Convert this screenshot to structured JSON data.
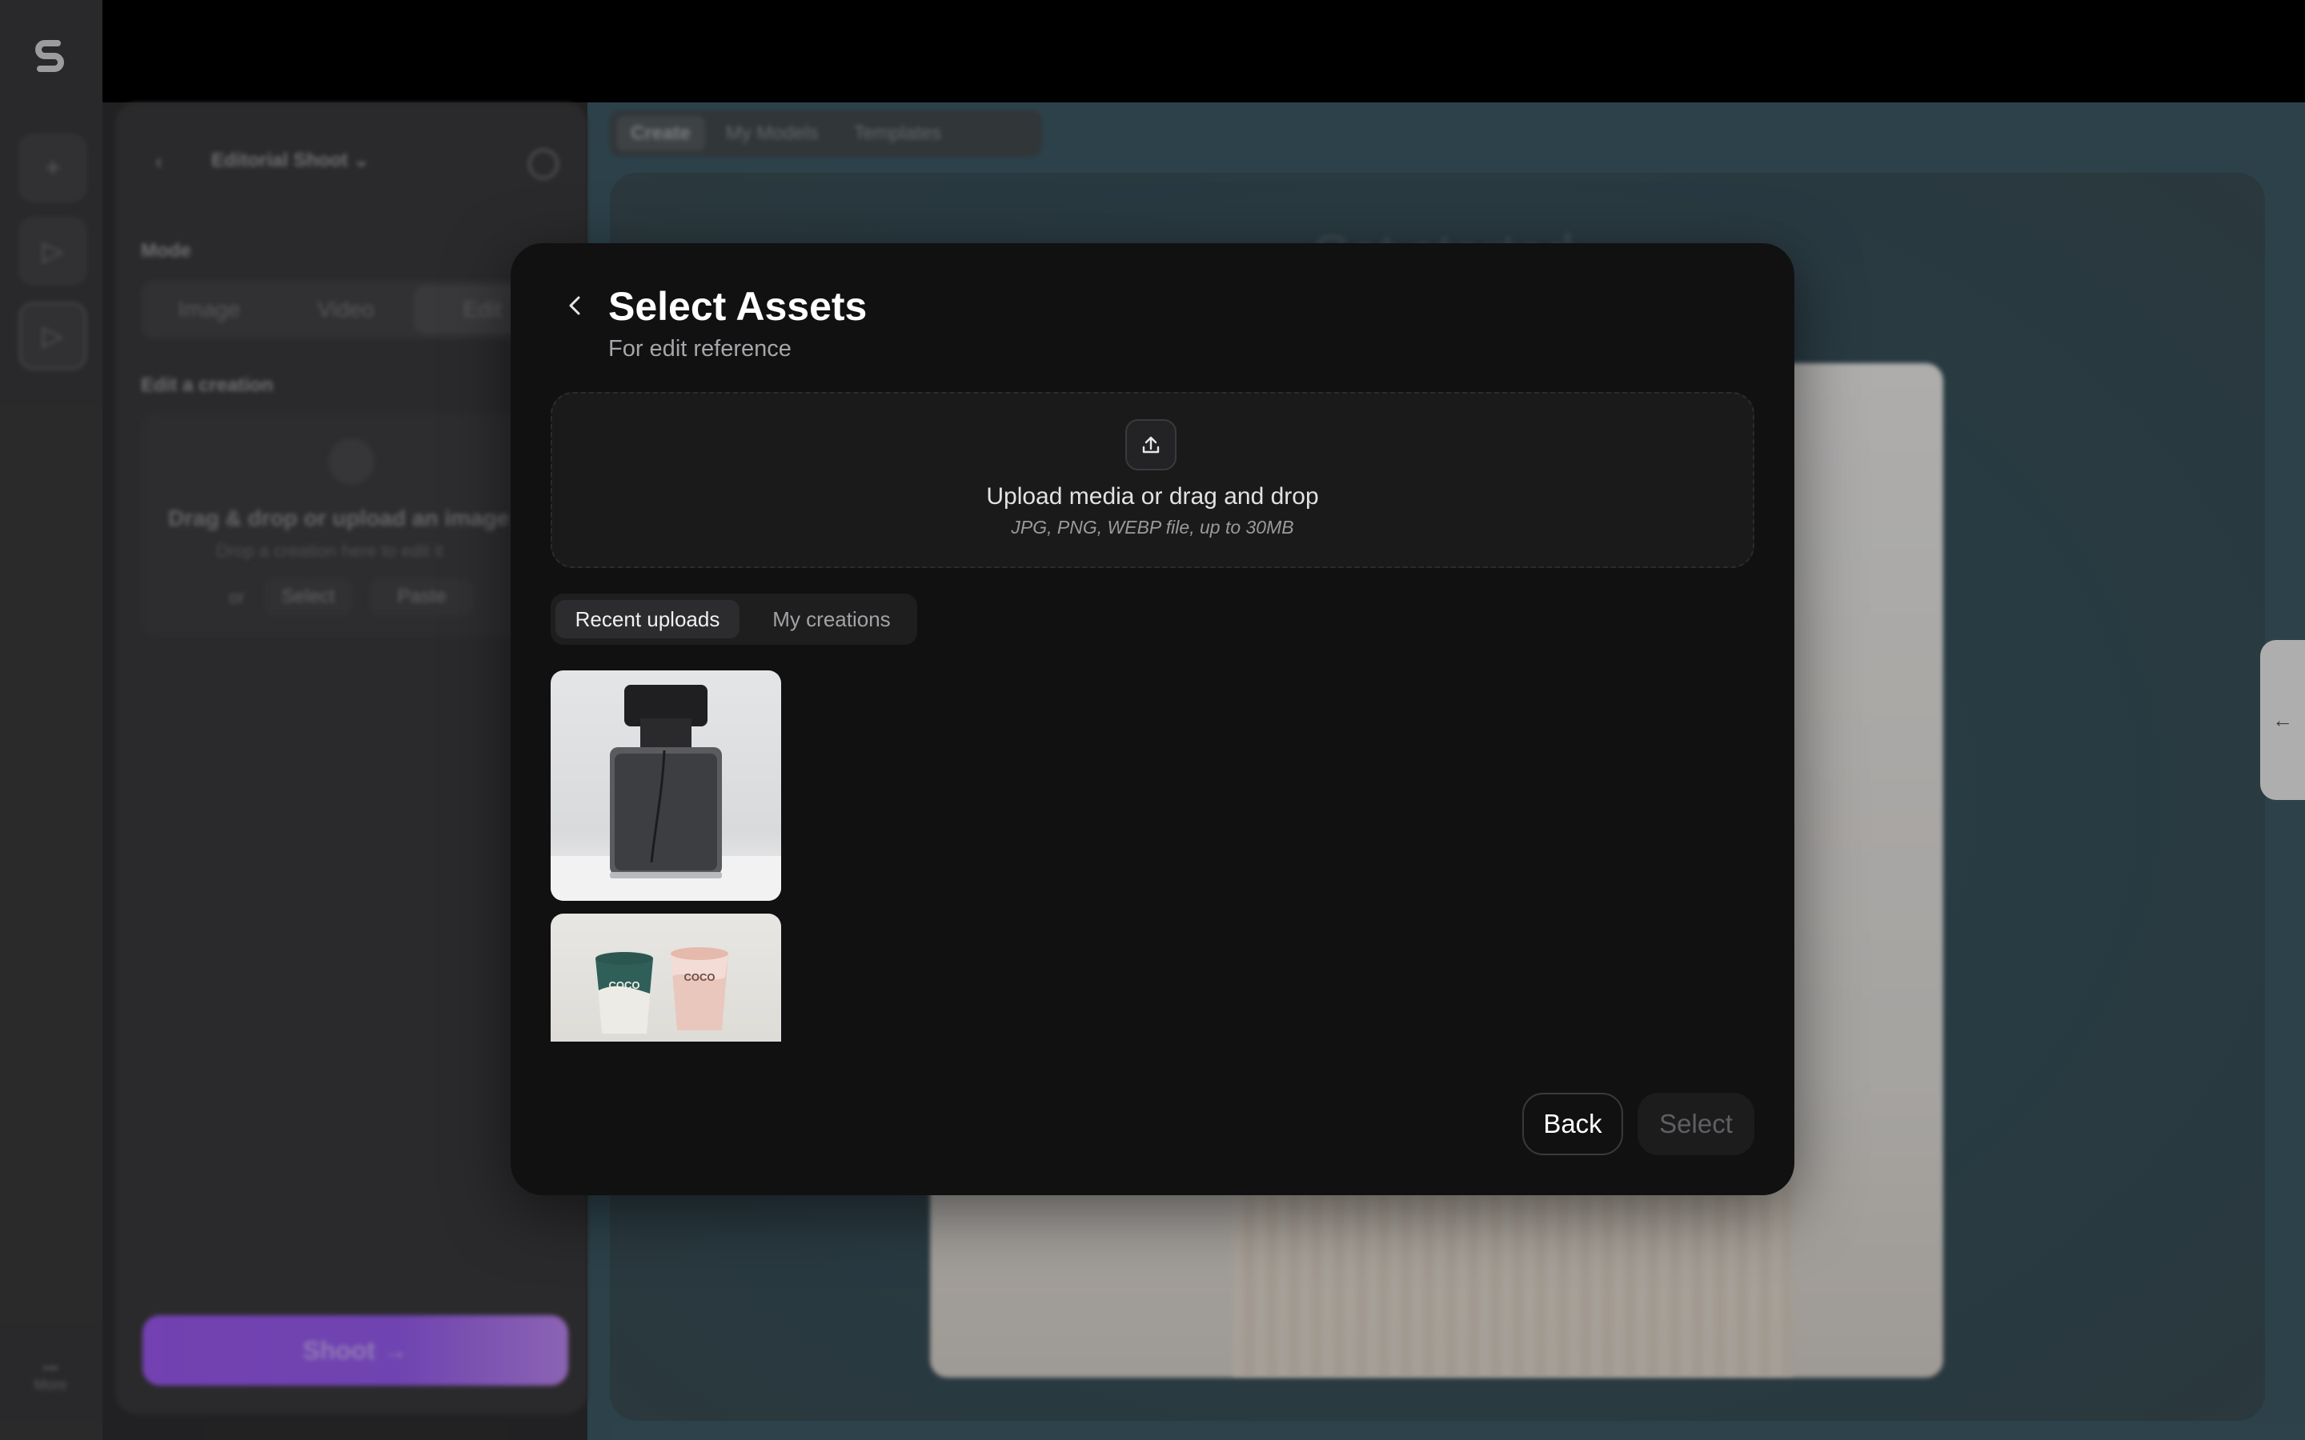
{
  "app": {
    "rail": {
      "more_label": "More",
      "icons": [
        "logo-icon",
        "plus-icon",
        "play-cursor-icon",
        "play-cursor-icon"
      ]
    },
    "panel": {
      "title": "Editorial Shoot",
      "mode_label": "Mode",
      "mode_tabs": [
        "Image",
        "Video",
        "Edit"
      ],
      "edit_label": "Edit a creation",
      "dropzone_text": "Drag & drop or upload an image",
      "dropzone_sub": "Drop a creation here to edit it",
      "or_label": "or",
      "select_label": "Select",
      "paste_label": "Paste",
      "shoot_label": "Shoot →"
    },
    "top_tabs": [
      "Create",
      "My Models",
      "Templates"
    ],
    "canvas_title": "Get started"
  },
  "modal": {
    "title": "Select Assets",
    "subtitle": "For edit reference",
    "upload": {
      "title": "Upload media or drag and drop",
      "subtitle": "JPG, PNG, WEBP file, up to 30MB"
    },
    "tabs": {
      "recent": "Recent uploads",
      "mine": "My creations",
      "selected": "Recent uploads"
    },
    "thumbnails": [
      {
        "name": "perfume-bottle-thumbnail"
      },
      {
        "name": "coco-cups-thumbnail",
        "label": "COCO"
      }
    ],
    "buttons": {
      "back": "Back",
      "select": "Select"
    }
  }
}
